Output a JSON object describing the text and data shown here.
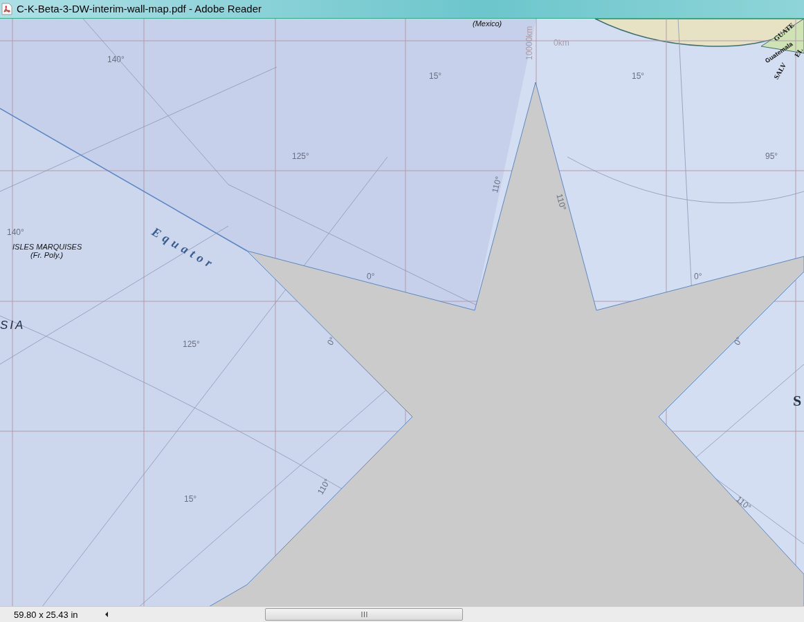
{
  "window": {
    "title": "C-K-Beta-3-DW-interim-wall-map.pdf - Adobe Reader"
  },
  "map_labels": [
    {
      "text": "(Mexico)",
      "kind": "place"
    },
    {
      "text": "0km",
      "kind": "scale"
    },
    {
      "text": "10000km",
      "kind": "scale"
    },
    {
      "text": "GUATE",
      "kind": "country"
    },
    {
      "text": "Guatemala",
      "kind": "city"
    },
    {
      "text": "EL",
      "kind": "country"
    },
    {
      "text": "SALV",
      "kind": "country"
    },
    {
      "text": "140°",
      "kind": "degree"
    },
    {
      "text": "15°",
      "kind": "degree"
    },
    {
      "text": "15°",
      "kind": "degree"
    },
    {
      "text": "125°",
      "kind": "degree"
    },
    {
      "text": "95°",
      "kind": "degree"
    },
    {
      "text": "110°",
      "kind": "degree"
    },
    {
      "text": "110°",
      "kind": "degree"
    },
    {
      "text": "Equator",
      "kind": "equator"
    },
    {
      "text": "140°",
      "kind": "degree"
    },
    {
      "text": "ISLES MARQUISES",
      "kind": "place"
    },
    {
      "text": "(Fr. Poly.)",
      "kind": "place"
    },
    {
      "text": "0°",
      "kind": "degree"
    },
    {
      "text": "0°",
      "kind": "degree"
    },
    {
      "text": "SIA",
      "kind": "region"
    },
    {
      "text": "125°",
      "kind": "degree"
    },
    {
      "text": "0°",
      "kind": "degree"
    },
    {
      "text": "0°",
      "kind": "degree"
    },
    {
      "text": "S",
      "kind": "ocean"
    },
    {
      "text": "15°",
      "kind": "degree"
    },
    {
      "text": "110°",
      "kind": "degree"
    },
    {
      "text": "110°",
      "kind": "degree"
    }
  ],
  "status_bar": {
    "page_size": "59.80 x 25.43 in"
  }
}
